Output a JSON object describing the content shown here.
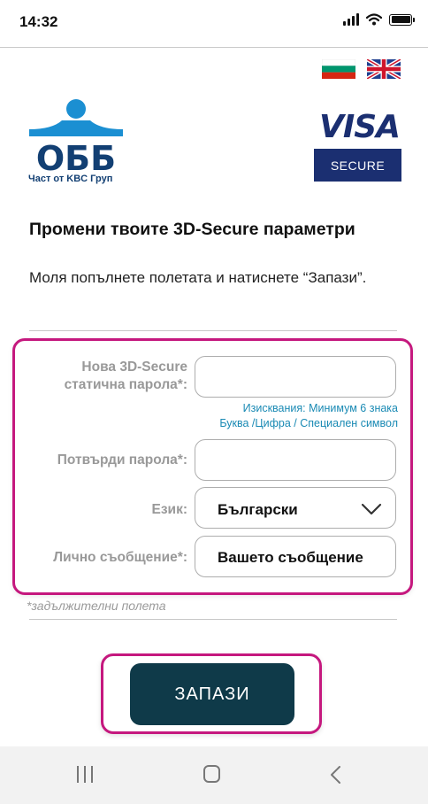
{
  "status_bar": {
    "time": "14:32"
  },
  "languages": [
    "bg",
    "en"
  ],
  "brand": {
    "bank_name": "ОББ",
    "tagline": "Част от KBC Груп",
    "visa_word": "VISA",
    "visa_secure": "SECURE",
    "colors": {
      "obb_blue": "#123f73",
      "obb_light_blue": "#1b8fd2",
      "visa_navy": "#1b2f71"
    }
  },
  "page": {
    "title": "Промени твоите 3D-Secure параметри",
    "instructions": "Моля попълнете полетата и натиснете “Запази”."
  },
  "form": {
    "password_label_line1": "Нова 3D-Secure",
    "password_label_line2": "статична парола*:",
    "password_value": "",
    "hint_line1": "Изисквания: Минимум 6 знака",
    "hint_line2": "Буква /Цифра / Специален символ",
    "confirm_label": "Потвърди парола*:",
    "confirm_value": "",
    "language_label": "Език:",
    "language_value": "Български",
    "message_label": "Лично съобщение*:",
    "message_value": "Вашето съобщение",
    "required_note": "*задължителни полета"
  },
  "actions": {
    "save_label": "ЗАПАЗИ"
  },
  "colors": {
    "accent_magenta": "#c5187e",
    "button_dark_teal": "#0f3a49",
    "hint_blue": "#1a8ab4"
  }
}
